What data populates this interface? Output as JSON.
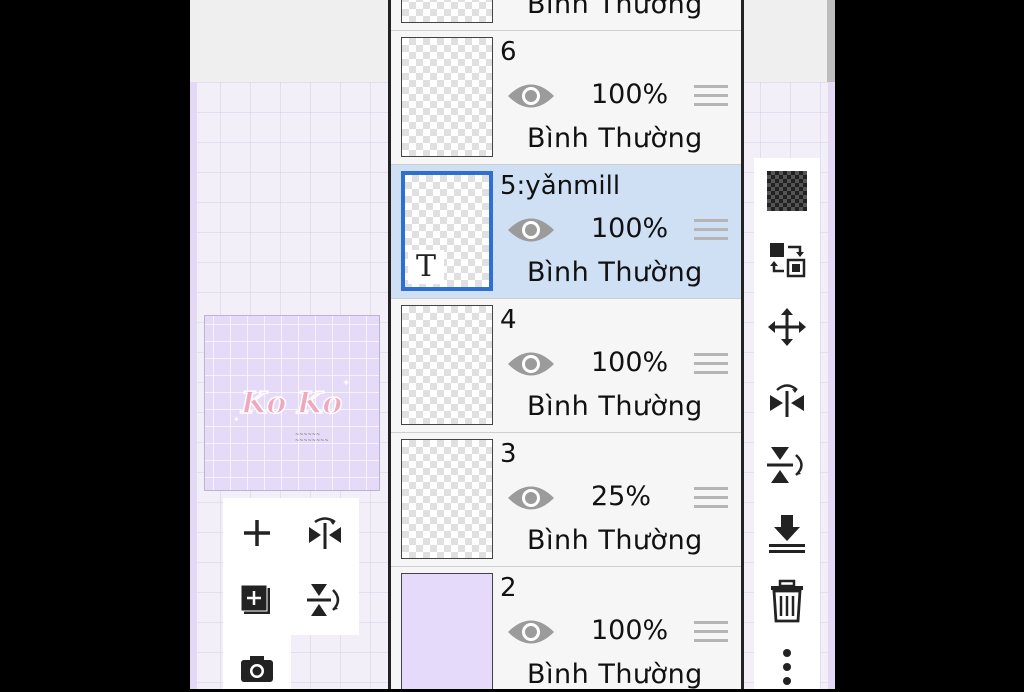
{
  "layers": [
    {
      "name": "",
      "opacity": "",
      "blend": "Bình Thường",
      "thumb": "checker"
    },
    {
      "name": "6",
      "opacity": "100%",
      "blend": "Bình Thường",
      "thumb": "checker"
    },
    {
      "name": "5:yǎnmill",
      "opacity": "100%",
      "blend": "Bình Thường",
      "thumb": "checker",
      "selected": true,
      "badge": "T"
    },
    {
      "name": "4",
      "opacity": "100%",
      "blend": "Bình Thường",
      "thumb": "checker"
    },
    {
      "name": "3",
      "opacity": "25%",
      "blend": "Bình Thường",
      "thumb": "checker"
    },
    {
      "name": "2",
      "opacity": "100%",
      "blend": "Bình Thường",
      "thumb": "purple"
    }
  ],
  "preview": {
    "text": "Ko Ko"
  },
  "left_tools": [
    "add-layer-icon",
    "flip-horizontal-icon",
    "add-folder-icon",
    "flip-vertical-icon",
    "camera-icon"
  ],
  "right_tools": [
    "transparency-icon",
    "swap-layer-icon",
    "move-icon",
    "flip-horizontal-icon",
    "flip-vertical-icon",
    "merge-down-icon",
    "delete-icon",
    "more-icon"
  ],
  "colors": {
    "selected_layer": "#cfdff4",
    "selected_border": "#2f6fd0",
    "canvas": "#e5dafa"
  }
}
